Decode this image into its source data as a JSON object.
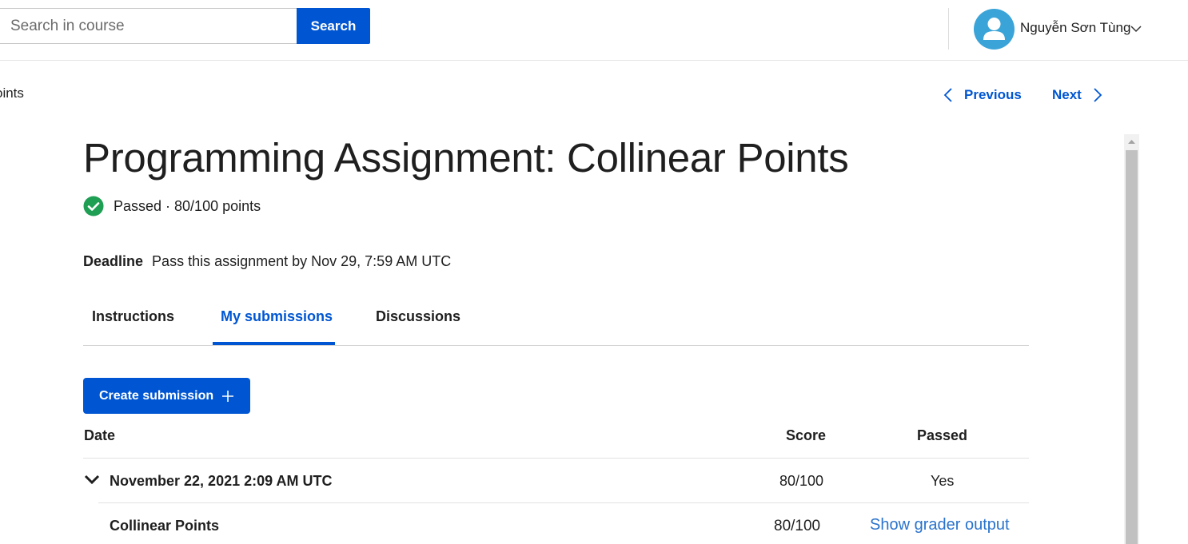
{
  "header": {
    "search_placeholder": "Search in course",
    "search_button": "Search",
    "user_name": "Nguyễn Sơn Tùng"
  },
  "nav": {
    "breadcrumb": "oints",
    "previous": "Previous",
    "next": "Next"
  },
  "assignment": {
    "title": "Programming Assignment: Collinear Points",
    "status": "Passed · 80/100 points",
    "deadline_label": "Deadline",
    "deadline_text": "Pass this assignment by Nov 29, 7:59 AM UTC"
  },
  "tabs": [
    {
      "label": "Instructions",
      "active": false
    },
    {
      "label": "My submissions",
      "active": true
    },
    {
      "label": "Discussions",
      "active": false
    }
  ],
  "create_button": "Create submission",
  "table": {
    "headers": {
      "date": "Date",
      "score": "Score",
      "passed": "Passed"
    },
    "submission": {
      "date": "November 22, 2021 2:09 AM UTC",
      "score": "80/100",
      "passed": "Yes"
    },
    "part": {
      "name": "Collinear Points",
      "score": "80/100",
      "link": "Show grader output"
    }
  },
  "colors": {
    "accent": "#0056d2",
    "success": "#1f9f54",
    "avatar": "#3aa4d8",
    "link": "#2a73cc"
  },
  "icons": [
    "user-icon",
    "chevron-down-icon",
    "chevron-left-icon",
    "chevron-right-icon",
    "check-circle-icon",
    "plus-icon",
    "caret-down-icon"
  ]
}
